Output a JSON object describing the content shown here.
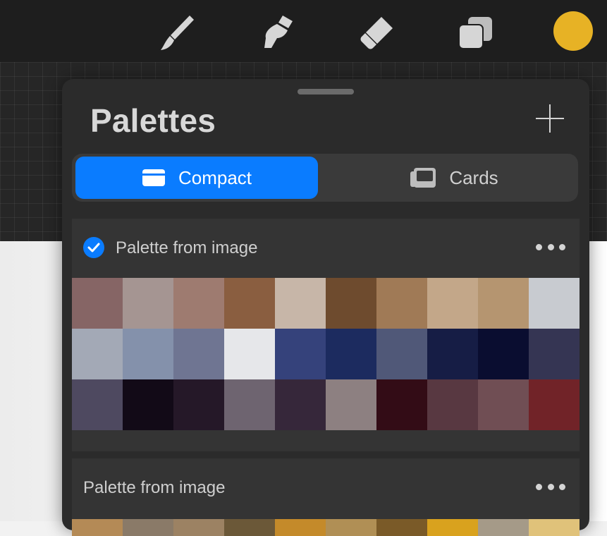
{
  "toolbar": {
    "tools": [
      {
        "icon": "brush-icon"
      },
      {
        "icon": "smudge-icon"
      },
      {
        "icon": "eraser-icon"
      },
      {
        "icon": "layers-icon"
      }
    ],
    "current_color": "#E7B225"
  },
  "palettes_panel": {
    "title": "Palettes",
    "add_icon": "plus-icon",
    "view_modes": [
      {
        "label": "Compact",
        "icon": "compact-view-icon",
        "active": true
      },
      {
        "label": "Cards",
        "icon": "cards-view-icon",
        "active": false
      }
    ],
    "palettes": [
      {
        "name": "Palette from image",
        "is_default": true,
        "more_icon": "more-icon",
        "swatches": [
          "#866565",
          "#A59592",
          "#9E7B70",
          "#8A5E40",
          "#C7B6A8",
          "#6E4B2E",
          "#A07A56",
          "#C3A789",
          "#B59570",
          "#C8CBD0",
          "#A3A9B6",
          "#8491AB",
          "#6F7592",
          "#E6E7EA",
          "#35427B",
          "#1C2B5F",
          "#505878",
          "#161D45",
          "#0A0D30",
          "#353553",
          "#4E4960",
          "#120A17",
          "#251828",
          "#6E6470",
          "#36273A",
          "#8D8081",
          "#330C16",
          "#583841",
          "#704E54",
          "#712328"
        ]
      },
      {
        "name": "Palette from image",
        "is_default": false,
        "more_icon": "more-icon",
        "swatches": [
          "#B48A56",
          "#8A7A68",
          "#9C8263",
          "#6B5838",
          "#C48A2A",
          "#B08F55",
          "#7A5A28",
          "#D9A21E",
          "#A59A88",
          "#E0C27A"
        ]
      }
    ]
  }
}
